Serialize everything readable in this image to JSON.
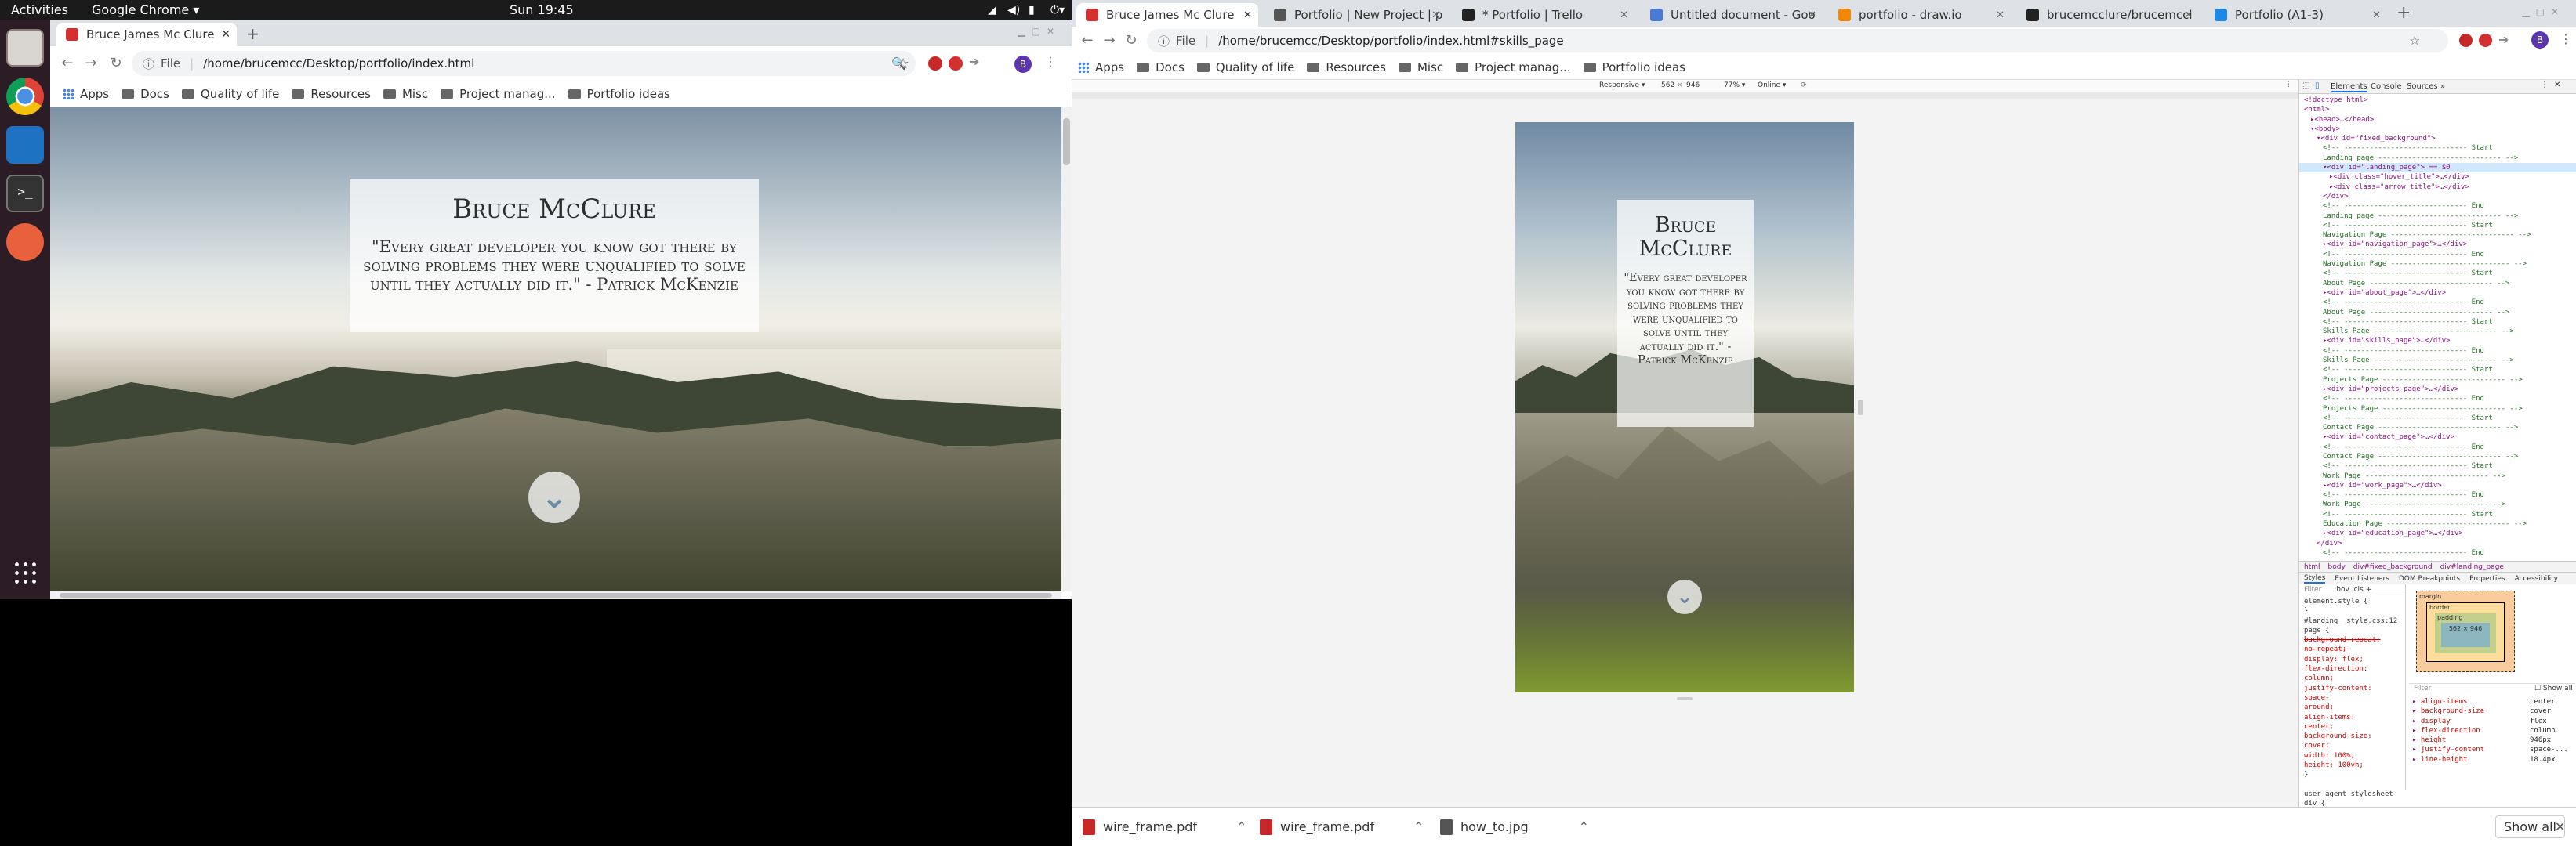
{
  "system": {
    "activities": "Activities",
    "app_menu": "Google Chrome",
    "clock": "Sun 19:45"
  },
  "left_browser": {
    "tab_title": "Bruce James Mc Clure",
    "url_scheme": "File",
    "url": "/home/brucemcc/Desktop/portfolio/index.html",
    "bookmarks": [
      "Apps",
      "Docs",
      "Quality of life",
      "Resources",
      "Misc",
      "Project manag...",
      "Portfolio ideas"
    ]
  },
  "hero": {
    "name": "Bruce McClure",
    "quote": "\"Every great developer you know got there by solving problems they were unqualified to solve until they actually did it.\" - Patrick McKenzie"
  },
  "right_browser": {
    "tabs": [
      {
        "title": "Bruce James Mc Clure",
        "color": "#d32f2f"
      },
      {
        "title": "Portfolio | New Project | p",
        "color": "#555555"
      },
      {
        "title": "* Portfolio | Trello",
        "color": "#222222"
      },
      {
        "title": "Untitled document - Goo",
        "color": "#4a7bd3"
      },
      {
        "title": "portfolio - draw.io",
        "color": "#f08705"
      },
      {
        "title": "brucemcclure/brucemccl",
        "color": "#222222"
      },
      {
        "title": "Portfolio (A1-3)",
        "color": "#1e88e5"
      }
    ],
    "url_scheme": "File",
    "url": "/home/brucemcc/Desktop/portfolio/index.html#skills_page",
    "bookmarks": [
      "Apps",
      "Docs",
      "Quality of life",
      "Resources",
      "Misc",
      "Project manag...",
      "Portfolio ideas"
    ],
    "device_toolbar": {
      "mode": "Responsive",
      "width": "562",
      "height": "946",
      "zoom": "77%",
      "network": "Online"
    },
    "devtools_tabs": [
      "Elements",
      "Console",
      "Sources"
    ],
    "dom_lines": [
      {
        "t": "<!doctype html>",
        "c": false,
        "i": 0
      },
      {
        "t": "<html>",
        "c": false,
        "i": 0
      },
      {
        "t": "▸<head>…</head>",
        "c": false,
        "i": 1
      },
      {
        "t": "▾<body>",
        "c": false,
        "i": 1
      },
      {
        "t": "▾<div id=\"fixed_background\">",
        "c": false,
        "i": 2
      },
      {
        "t": "<!-- ----------------------------- Start",
        "c": true,
        "i": 3
      },
      {
        "t": "Landing page ----------------------------- -->",
        "c": true,
        "i": 3
      },
      {
        "t": "▾<div id=\"landing_page\"> == $0",
        "c": false,
        "i": 3
      },
      {
        "t": "▸<div class=\"hover_title\">…</div>",
        "c": false,
        "i": 4
      },
      {
        "t": "▸<div class=\"arrow_title\">…</div>",
        "c": false,
        "i": 4
      },
      {
        "t": "</div>",
        "c": false,
        "i": 3
      },
      {
        "t": "<!-- ----------------------------- End",
        "c": true,
        "i": 3
      },
      {
        "t": "Landing page ----------------------------- -->",
        "c": true,
        "i": 3
      },
      {
        "t": "<!-- ----------------------------- Start",
        "c": true,
        "i": 3
      },
      {
        "t": "Navigation Page ----------------------------- -->",
        "c": true,
        "i": 3
      },
      {
        "t": "▸<div id=\"navigation_page\">…</div>",
        "c": false,
        "i": 3
      },
      {
        "t": "<!-- ----------------------------- End",
        "c": true,
        "i": 3
      },
      {
        "t": "Navigation Page ---------------------------- -->",
        "c": true,
        "i": 3
      },
      {
        "t": "<!-- ----------------------------- Start",
        "c": true,
        "i": 3
      },
      {
        "t": "About Page ----------------------------- -->",
        "c": true,
        "i": 3
      },
      {
        "t": "▸<div id=\"about_page\">…</div>",
        "c": false,
        "i": 3
      },
      {
        "t": "<!-- ----------------------------- End",
        "c": true,
        "i": 3
      },
      {
        "t": "About Page ----------------------------- -->",
        "c": true,
        "i": 3
      },
      {
        "t": "<!-- ----------------------------- Start",
        "c": true,
        "i": 3
      },
      {
        "t": "Skills Page ----------------------------- -->",
        "c": true,
        "i": 3
      },
      {
        "t": "▸<div id=\"skills_page\">…</div>",
        "c": false,
        "i": 3
      },
      {
        "t": "<!-- ----------------------------- End",
        "c": true,
        "i": 3
      },
      {
        "t": "Skills Page ----------------------------- -->",
        "c": true,
        "i": 3
      },
      {
        "t": "<!-- ----------------------------- Start",
        "c": true,
        "i": 3
      },
      {
        "t": "Projects Page ----------------------------- -->",
        "c": true,
        "i": 3
      },
      {
        "t": "▸<div id=\"projects_page\">…</div>",
        "c": false,
        "i": 3
      },
      {
        "t": "<!-- ----------------------------- End",
        "c": true,
        "i": 3
      },
      {
        "t": "Projects Page ----------------------------- -->",
        "c": true,
        "i": 3
      },
      {
        "t": "<!-- ----------------------------- Start",
        "c": true,
        "i": 3
      },
      {
        "t": "Contact Page ----------------------------- -->",
        "c": true,
        "i": 3
      },
      {
        "t": "▸<div id=\"contact_page\">…</div>",
        "c": false,
        "i": 3
      },
      {
        "t": "<!-- ----------------------------- End",
        "c": true,
        "i": 3
      },
      {
        "t": "Contact Page ----------------------------- -->",
        "c": true,
        "i": 3
      },
      {
        "t": "<!-- ----------------------------- Start",
        "c": true,
        "i": 3
      },
      {
        "t": "Work Page ----------------------------- -->",
        "c": true,
        "i": 3
      },
      {
        "t": "▸<div id=\"work_page\">…</div>",
        "c": false,
        "i": 3
      },
      {
        "t": "<!-- ----------------------------- End",
        "c": true,
        "i": 3
      },
      {
        "t": "Work Page ----------------------------- -->",
        "c": true,
        "i": 3
      },
      {
        "t": "<!-- ----------------------------- Start",
        "c": true,
        "i": 3
      },
      {
        "t": "Education Page ----------------------------- -->",
        "c": true,
        "i": 3
      },
      {
        "t": "▸<div id=\"education_page\">…</div>",
        "c": false,
        "i": 3
      },
      {
        "t": "</div>",
        "c": false,
        "i": 2
      },
      {
        "t": "<!-- ----------------------------- End",
        "c": true,
        "i": 3
      }
    ],
    "breadcrumb": [
      "html",
      "body",
      "div#fixed_background",
      "div#landing_page"
    ],
    "styles_tabs": [
      "Styles",
      "Event Listeners",
      "DOM Breakpoints",
      "Properties",
      "Accessibility"
    ],
    "filter_placeholder": "Filter",
    "hov_cls": ":hov  .cls  +",
    "css_rules": [
      "element.style {",
      "}",
      "#landing_  style.css:12",
      "page {",
      "  background-repeat:",
      "     no-repeat;",
      "  display: flex;",
      "  flex-direction:",
      "     column;",
      "  justify-content:",
      "     space-",
      "     around;",
      "  align-items:",
      "     center;",
      "  background-size:",
      "     cover;",
      "  width: 100%;",
      "  height: 100vh;",
      "}",
      "",
      "user agent stylesheet",
      "div {"
    ],
    "box_model": {
      "margin_label": "margin",
      "border_label": "border",
      "padding_label": "padding",
      "content": "562 × 946"
    },
    "computed_filter": "Filter",
    "show_all": "Show all",
    "computed": [
      {
        "k": "align-items",
        "v": "center"
      },
      {
        "k": "background-size",
        "v": "cover"
      },
      {
        "k": "display",
        "v": "flex"
      },
      {
        "k": "flex-direction",
        "v": "column"
      },
      {
        "k": "height",
        "v": "946px"
      },
      {
        "k": "justify-content",
        "v": "space-..."
      },
      {
        "k": "line-height",
        "v": "18.4px"
      }
    ],
    "downloads": [
      "wire_frame.pdf",
      "wire_frame.pdf",
      "how_to.jpg"
    ],
    "downloads_show_all": "Show all"
  },
  "colors": {
    "accent_red": "#d32f2f",
    "chevron": "#6c8aa5",
    "dock_bg": "#2b1c26"
  }
}
